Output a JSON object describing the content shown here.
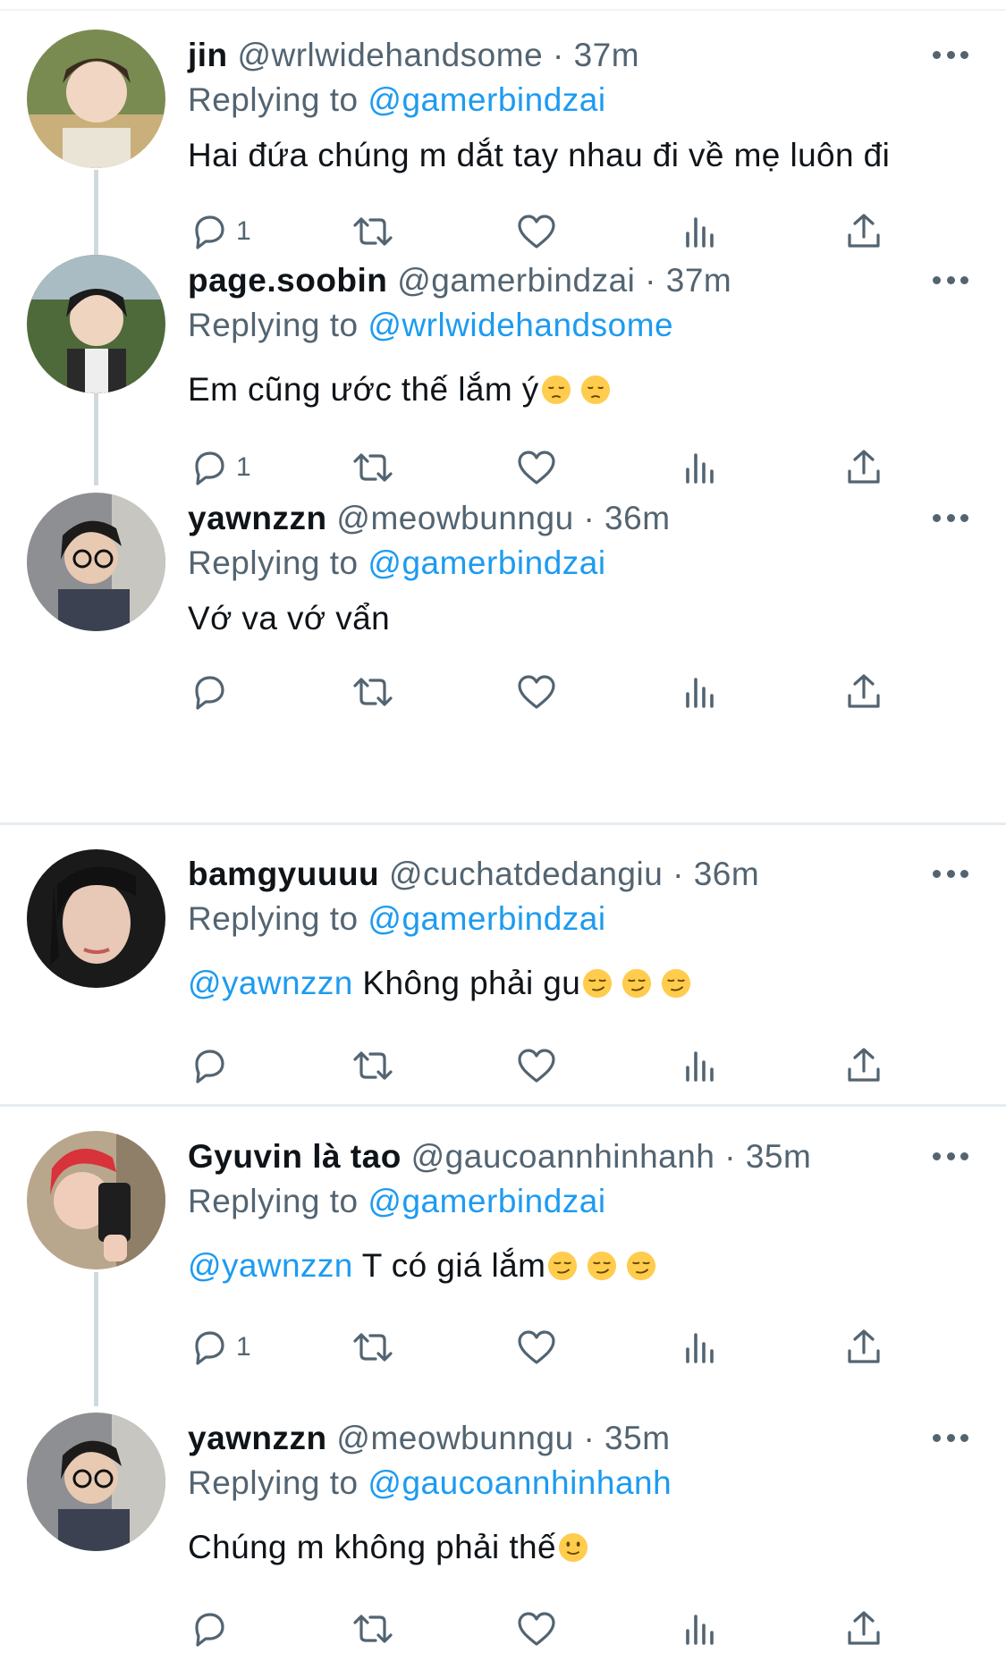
{
  "tweets": [
    {
      "name": "jin",
      "handle": "@wrlwidehandsome",
      "dot": "·",
      "time": "37m",
      "replying_label": "Replying to",
      "replying_to": "@gamerbindzai",
      "mention": "",
      "text": "Hai đứa chúng m dắt tay nhau đi về mẹ luôn đi",
      "emojis": [],
      "reply_count": "1"
    },
    {
      "name": "page.soobin",
      "handle": "@gamerbindzai",
      "dot": "·",
      "time": "37m",
      "replying_label": "Replying to",
      "replying_to": "@wrlwidehandsome",
      "mention": "",
      "text": "Em cũng ước thế lắm ý",
      "emojis": [
        "pensive-face",
        "pensive-face"
      ],
      "reply_count": "1"
    },
    {
      "name": "yawnzzn",
      "handle": "@meowbunngu",
      "dot": "·",
      "time": "36m",
      "replying_label": "Replying to",
      "replying_to": "@gamerbindzai",
      "mention": "",
      "text": "Vớ va vớ vẩn",
      "emojis": [],
      "reply_count": ""
    },
    {
      "name": "bamgyuuuu",
      "handle": "@cuchatdedangiu",
      "dot": "·",
      "time": "36m",
      "replying_label": "Replying to",
      "replying_to": "@gamerbindzai",
      "mention": "@yawnzzn",
      "text": " Không phải gu",
      "emojis": [
        "smirking-face",
        "smirking-face",
        "smirking-face"
      ],
      "reply_count": ""
    },
    {
      "name": "Gyuvin là tao",
      "handle": "@gaucoannhinhanh",
      "dot": "·",
      "time": "35m",
      "replying_label": "Replying to",
      "replying_to": "@gamerbindzai",
      "mention": "@yawnzzn",
      "text": " T có giá lắm",
      "emojis": [
        "smirking-face",
        "smirking-face",
        "smirking-face"
      ],
      "reply_count": "1"
    },
    {
      "name": "yawnzzn",
      "handle": "@meowbunngu",
      "dot": "·",
      "time": "35m",
      "replying_label": "Replying to",
      "replying_to": "@gaucoannhinhanh",
      "mention": "",
      "text": "Chúng m không phải thế",
      "emojis": [
        "slightly-smiling-face"
      ],
      "reply_count": ""
    }
  ],
  "icons": {
    "reply": "reply-icon",
    "retweet": "retweet-icon",
    "like": "like-icon",
    "views": "views-icon",
    "share": "share-icon",
    "more": "more-icon"
  },
  "colors": {
    "link": "#1d9bf0",
    "secondary_text": "#536471",
    "thread_line": "#cfd9de",
    "separator": "#e6ecf0"
  }
}
